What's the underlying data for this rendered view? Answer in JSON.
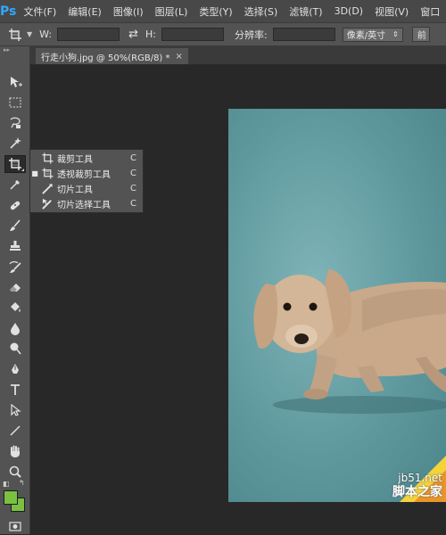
{
  "app": {
    "logo": "Ps",
    "accent": "#31a8ff"
  },
  "menu": [
    "文件(F)",
    "编辑(E)",
    "图像(I)",
    "图层(L)",
    "类型(Y)",
    "选择(S)",
    "滤镜(T)",
    "3D(D)",
    "视图(V)",
    "窗口"
  ],
  "options": {
    "w_label": "W:",
    "swap_icon": "swap-arrows-icon",
    "h_label": "H:",
    "resolution_label": "分辨率:",
    "unit_select": "像素/英寸",
    "button_partial": "前"
  },
  "document": {
    "tab_title": "行走小狗.jpg @ 50%(RGB/8) *",
    "close": "×"
  },
  "flyout": {
    "items": [
      {
        "label": "裁剪工具",
        "key": "C",
        "icon": "crop-icon",
        "current": false
      },
      {
        "label": "透视裁剪工具",
        "key": "C",
        "icon": "perspective-crop-icon",
        "current": true
      },
      {
        "label": "切片工具",
        "key": "C",
        "icon": "slice-icon",
        "current": false
      },
      {
        "label": "切片选择工具",
        "key": "C",
        "icon": "slice-select-icon",
        "current": false
      }
    ],
    "bullet": "■"
  },
  "colors": {
    "foreground": "#7ac142",
    "background": "#7ac142",
    "canvas_bg": "#282828",
    "photo_bg": "#5f999e"
  },
  "watermark": {
    "url": "jb51.net",
    "cn": "脚本之家"
  }
}
